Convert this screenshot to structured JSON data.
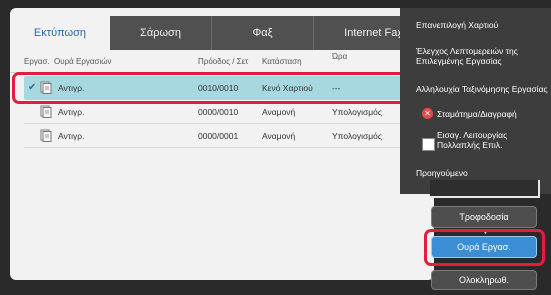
{
  "tabs": [
    {
      "label": "Εκτύπωση",
      "active": true
    },
    {
      "label": "Σάρωση",
      "active": false
    },
    {
      "label": "Φαξ",
      "active": false
    },
    {
      "label": "Internet Fax",
      "active": false
    }
  ],
  "columns": [
    "Εργασ.",
    "Ουρά Εργασιών",
    "Πρόοδος / Σετ",
    "Κατάσταση",
    "Ώρα"
  ],
  "rows": [
    {
      "type": "Αντιγρ.",
      "progress": "0010/0010",
      "status": "Κενό Χαρτιού",
      "time": "---",
      "selected": true
    },
    {
      "type": "Αντιγρ.",
      "progress": "0000/0010",
      "status": "Αναμονή",
      "time": "Υπολογισμός",
      "selected": false
    },
    {
      "type": "Αντιγρ.",
      "progress": "0000/0001",
      "status": "Αναμονή",
      "time": "Υπολογισμός",
      "selected": false
    }
  ],
  "menu": {
    "items": [
      {
        "label": "Επανεπιλογή Χαρτιού"
      },
      {
        "label": "Έλεγχος Λεπτομερειών της Επιλεγμένης Εργασίας"
      },
      {
        "label": "Αλληλουχία Ταξινόμησης Εργασίας"
      },
      {
        "label": "Σταμάτημα/Διαγραφή"
      },
      {
        "label": "Εισαγ. Λειτουργίας Πολλαπλής Επιλ."
      },
      {
        "label": "Προηγούμενο"
      }
    ]
  },
  "buttons": {
    "supply": "Τροφοδοσία",
    "queue": "Ουρά Εργασ.",
    "complete": "Ολοκληρωθ."
  },
  "colors": {
    "highlight": "#e31d3f",
    "selected_row": "#a8d8df",
    "active_button": "#3b8ed3"
  }
}
